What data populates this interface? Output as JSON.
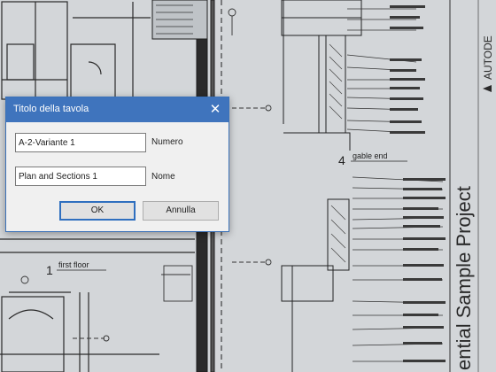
{
  "dialog": {
    "title": "Titolo della tavola",
    "number_value": "A-2-Variante 1",
    "number_label": "Numero",
    "name_value": "Plan and Sections 1",
    "name_label": "Nome",
    "ok_label": "OK",
    "cancel_label": "Annulla"
  },
  "drawing": {
    "sidebar_text": "ential Sample Project",
    "brand": "AUTODE",
    "view_number": "4",
    "view_name": "gable end",
    "floor_number": "1",
    "floor_label": "first floor"
  }
}
